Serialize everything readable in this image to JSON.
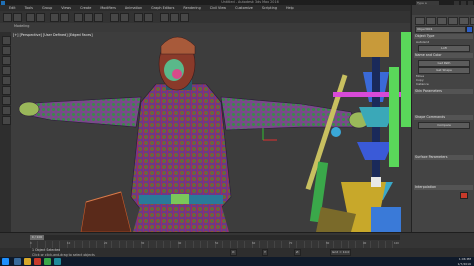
{
  "window": {
    "title": "Untitled - Autodesk 3ds Max 2016",
    "search_placeholder": "Type a keyword",
    "brand_color": "#1f6fb5"
  },
  "menu": [
    "Edit",
    "Tools",
    "Group",
    "Views",
    "Create",
    "Modifiers",
    "Animation",
    "Graph Editors",
    "Rendering",
    "Civil View",
    "Customize",
    "Scripting",
    "Help"
  ],
  "ribbon": {
    "label": "Modeling"
  },
  "viewport": {
    "label": "[+] [Perspective] [User Defined] [Edged Faces]"
  },
  "command_panel": {
    "object_name": "Object001",
    "rollouts": [
      "Object Type",
      "Name and Color",
      "Skin Parameters",
      "Shape Commands",
      "Surface Parameters",
      "Interpolation"
    ],
    "params": [
      "AutoGrid",
      "Loft",
      "Get Path",
      "Get Shape",
      "Move",
      "Copy",
      "Instance"
    ],
    "buttons": [
      "Compare"
    ]
  },
  "timeline": {
    "frame_display": "0 / 100",
    "labels": [
      "0",
      "10",
      "20",
      "30",
      "40",
      "50",
      "60",
      "70",
      "80",
      "90",
      "100"
    ]
  },
  "status": {
    "selection": "1 Object Selected",
    "prompt": "Click or click-and-drag to select objects",
    "coords": {
      "x": "X:",
      "y": "Y:",
      "z": "Z:"
    },
    "grid": "Grid = 10.0"
  },
  "taskbar": {
    "time": "1:06 PM",
    "date": "1/7/2016"
  },
  "colors": {
    "accent": "#2d5fc8",
    "object_swatch": "#c83a2a"
  }
}
